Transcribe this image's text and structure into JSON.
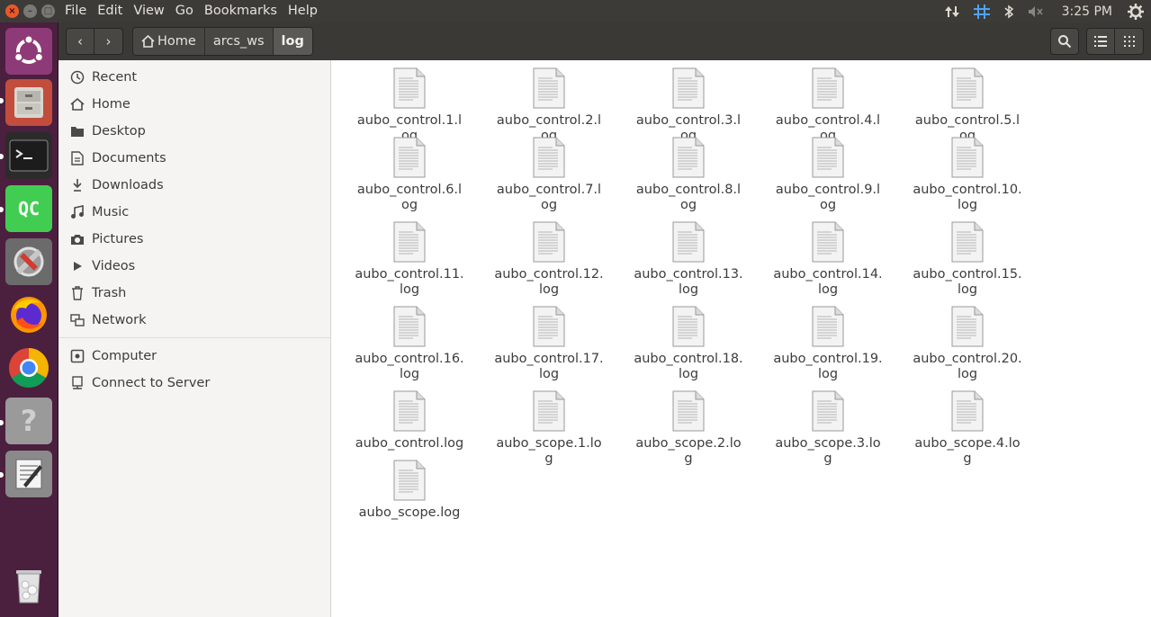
{
  "window_controls": {
    "close": "×",
    "minimize": "–",
    "maximize": "□"
  },
  "menu": [
    "File",
    "Edit",
    "View",
    "Go",
    "Bookmarks",
    "Help"
  ],
  "indicators": {
    "clock": "3:25 PM"
  },
  "launcher": {
    "items": [
      "ubuntu-dash",
      "files",
      "terminal",
      "qt-creator",
      "system-tools",
      "firefox",
      "chrome",
      "help",
      "text-editor",
      "trash"
    ],
    "qc_label": "QC",
    "help_label": "?"
  },
  "toolbar": {
    "back": "‹",
    "forward": "›",
    "path": [
      "Home",
      "arcs_ws",
      "log"
    ]
  },
  "sidebar": {
    "places": [
      "Recent",
      "Home",
      "Desktop",
      "Documents",
      "Downloads",
      "Music",
      "Pictures",
      "Videos",
      "Trash",
      "Network"
    ],
    "devices": [
      "Computer",
      "Connect to Server"
    ]
  },
  "files": [
    "aubo_control.1.log",
    "aubo_control.2.log",
    "aubo_control.3.log",
    "aubo_control.4.log",
    "aubo_control.5.log",
    "aubo_control.6.log",
    "aubo_control.7.log",
    "aubo_control.8.log",
    "aubo_control.9.log",
    "aubo_control.10.\nlog",
    "aubo_control.11.\nlog",
    "aubo_control.12.\nlog",
    "aubo_control.13.\nlog",
    "aubo_control.14.\nlog",
    "aubo_control.15.\nlog",
    "aubo_control.16.\nlog",
    "aubo_control.17.\nlog",
    "aubo_control.18.\nlog",
    "aubo_control.19.\nlog",
    "aubo_control.20.\nlog",
    "aubo_control.log",
    "aubo_scope.1.log",
    "aubo_scope.2.log",
    "aubo_scope.3.log",
    "aubo_scope.4.log",
    "aubo_scope.log"
  ],
  "colors": {
    "panel": "#3c3b37",
    "launcher": "#4b1f3e",
    "close": "#e9582b"
  }
}
